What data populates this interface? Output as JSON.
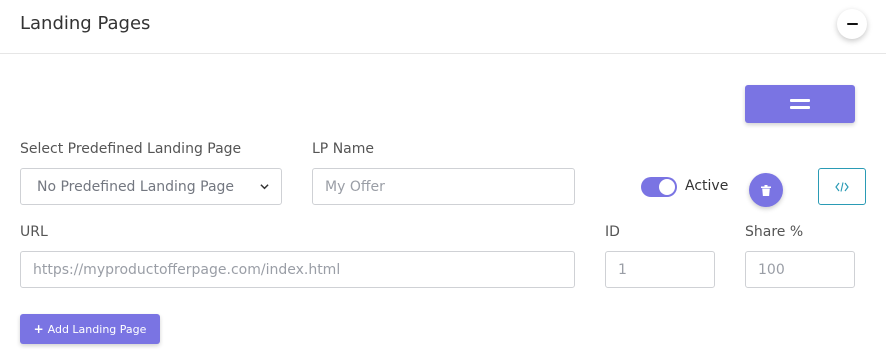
{
  "card": {
    "title": "Landing Pages",
    "collapse_icon": "minus-icon"
  },
  "toolbar": {
    "drag_icon": "drag-handle-icon",
    "accent_color": "#7a74e3"
  },
  "form": {
    "predefined": {
      "label": "Select Predefined Landing Page",
      "selected": "No Predefined Landing Page"
    },
    "lp_name": {
      "label": "LP Name",
      "placeholder": "My Offer"
    },
    "active": {
      "label": "Active",
      "checked": true
    },
    "url": {
      "label": "URL",
      "placeholder": "https://myproductofferpage.com/index.html"
    },
    "id": {
      "label": "ID",
      "placeholder": "1"
    },
    "share": {
      "label": "Share %",
      "placeholder": "100"
    },
    "delete_icon": "trash-icon",
    "code_icon": "code-icon",
    "code_border_color": "#2a9bb5"
  },
  "actions": {
    "add_label": "Add Landing Page",
    "add_icon": "plus-icon"
  }
}
